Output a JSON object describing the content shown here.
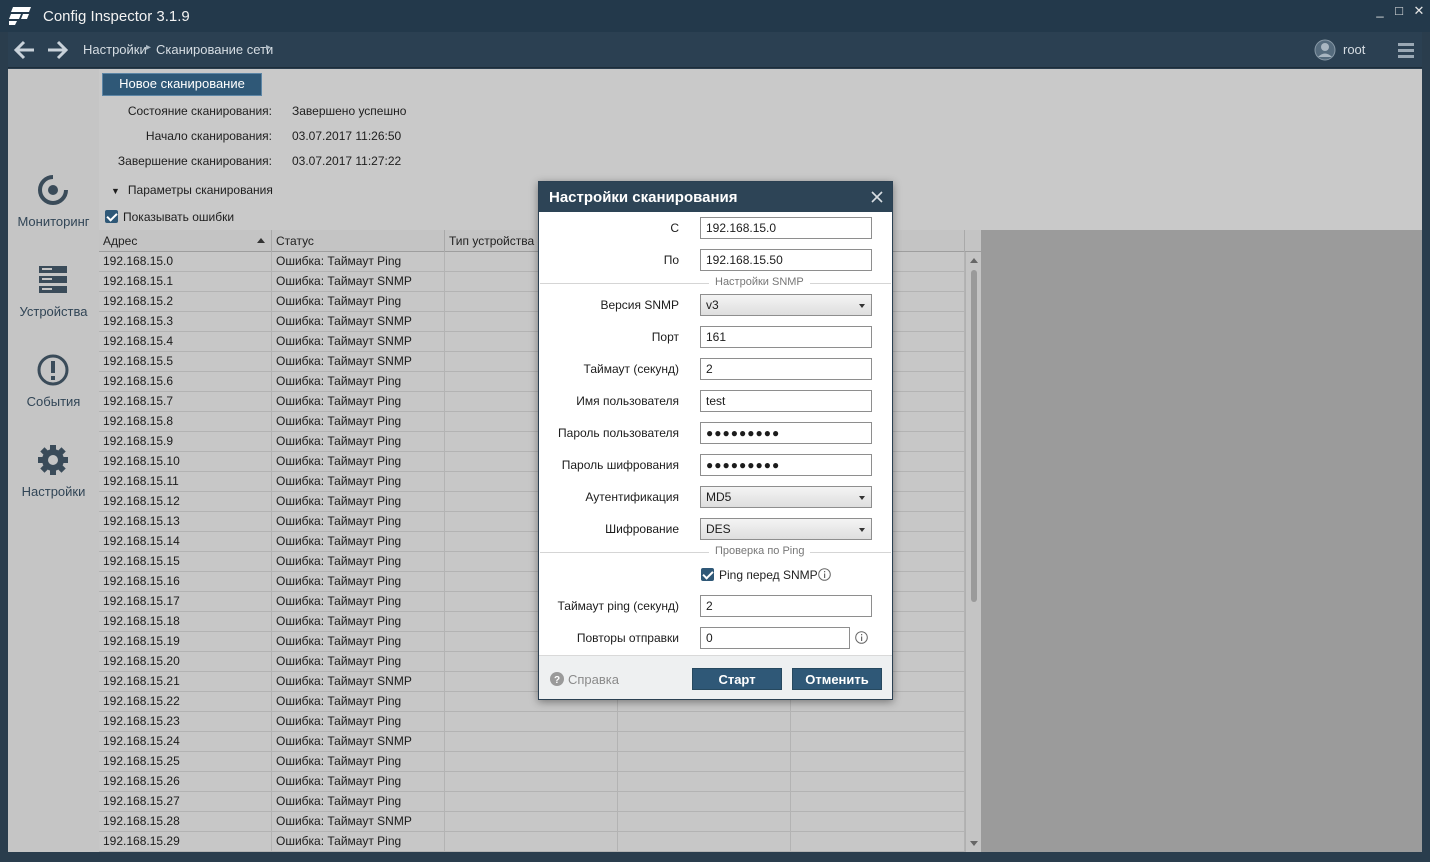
{
  "window": {
    "title": "Config Inspector 3.1.9",
    "minimize": "_",
    "maximize": "□",
    "close": "✕"
  },
  "nav": {
    "breadcrumbs": [
      "Настройки",
      "Сканирование сети"
    ],
    "user": "root"
  },
  "sidebar": {
    "items": [
      {
        "label": "Мониторинг",
        "icon": "monitoring-icon"
      },
      {
        "label": "Устройства",
        "icon": "devices-icon"
      },
      {
        "label": "События",
        "icon": "events-icon"
      },
      {
        "label": "Настройки",
        "icon": "gear-icon"
      }
    ]
  },
  "scan": {
    "new_scan_label": "Новое сканирование",
    "state_label": "Состояние сканирования:",
    "state_value": "Завершено успешно",
    "start_label": "Начало сканирования:",
    "start_value": "03.07.2017 11:26:50",
    "end_label": "Завершение сканирования:",
    "end_value": "03.07.2017 11:27:22",
    "params_label": "Параметры сканирования",
    "show_errors_label": "Показывать ошибки"
  },
  "table": {
    "columns": [
      "Адрес",
      "Статус",
      "Тип устройства"
    ],
    "rows": [
      [
        "192.168.15.0",
        "Ошибка: Таймаут Ping"
      ],
      [
        "192.168.15.1",
        "Ошибка: Таймаут SNMP"
      ],
      [
        "192.168.15.2",
        "Ошибка: Таймаут Ping"
      ],
      [
        "192.168.15.3",
        "Ошибка: Таймаут SNMP"
      ],
      [
        "192.168.15.4",
        "Ошибка: Таймаут SNMP"
      ],
      [
        "192.168.15.5",
        "Ошибка: Таймаут SNMP"
      ],
      [
        "192.168.15.6",
        "Ошибка: Таймаут Ping"
      ],
      [
        "192.168.15.7",
        "Ошибка: Таймаут Ping"
      ],
      [
        "192.168.15.8",
        "Ошибка: Таймаут Ping"
      ],
      [
        "192.168.15.9",
        "Ошибка: Таймаут Ping"
      ],
      [
        "192.168.15.10",
        "Ошибка: Таймаут Ping"
      ],
      [
        "192.168.15.11",
        "Ошибка: Таймаут Ping"
      ],
      [
        "192.168.15.12",
        "Ошибка: Таймаут Ping"
      ],
      [
        "192.168.15.13",
        "Ошибка: Таймаут Ping"
      ],
      [
        "192.168.15.14",
        "Ошибка: Таймаут Ping"
      ],
      [
        "192.168.15.15",
        "Ошибка: Таймаут Ping"
      ],
      [
        "192.168.15.16",
        "Ошибка: Таймаут Ping"
      ],
      [
        "192.168.15.17",
        "Ошибка: Таймаут Ping"
      ],
      [
        "192.168.15.18",
        "Ошибка: Таймаут Ping"
      ],
      [
        "192.168.15.19",
        "Ошибка: Таймаут Ping"
      ],
      [
        "192.168.15.20",
        "Ошибка: Таймаут Ping"
      ],
      [
        "192.168.15.21",
        "Ошибка: Таймаут SNMP"
      ],
      [
        "192.168.15.22",
        "Ошибка: Таймаут Ping"
      ],
      [
        "192.168.15.23",
        "Ошибка: Таймаут Ping"
      ],
      [
        "192.168.15.24",
        "Ошибка: Таймаут SNMP"
      ],
      [
        "192.168.15.25",
        "Ошибка: Таймаут Ping"
      ],
      [
        "192.168.15.26",
        "Ошибка: Таймаут Ping"
      ],
      [
        "192.168.15.27",
        "Ошибка: Таймаут Ping"
      ],
      [
        "192.168.15.28",
        "Ошибка: Таймаут SNMP"
      ],
      [
        "192.168.15.29",
        "Ошибка: Таймаут Ping"
      ]
    ]
  },
  "dialog": {
    "title": "Настройки сканирования",
    "from_label": "С",
    "from_value": "192.168.15.0",
    "to_label": "По",
    "to_value": "192.168.15.50",
    "snmp_section": "Настройки SNMP",
    "snmp_version_label": "Версия SNMP",
    "snmp_version_value": "v3",
    "port_label": "Порт",
    "port_value": "161",
    "timeout_label": "Таймаут (секунд)",
    "timeout_value": "2",
    "username_label": "Имя пользователя",
    "username_value": "test",
    "user_password_label": "Пароль пользователя",
    "user_password_value": "●●●●●●●●●",
    "enc_password_label": "Пароль шифрования",
    "enc_password_value": "●●●●●●●●●",
    "auth_label": "Аутентификация",
    "auth_value": "MD5",
    "encryption_label": "Шифрование",
    "encryption_value": "DES",
    "ping_section": "Проверка по Ping",
    "ping_before_snmp_label": "Ping перед SNMP",
    "ping_timeout_label": "Таймаут ping (секунд)",
    "ping_timeout_value": "2",
    "retries_label": "Повторы отправки",
    "retries_value": "0",
    "help_label": "Справка",
    "start_label": "Старт",
    "cancel_label": "Отменить"
  },
  "colors": {
    "titlebar": "#23394b",
    "accent": "#2f5877",
    "dialog_header": "#2d4456"
  }
}
